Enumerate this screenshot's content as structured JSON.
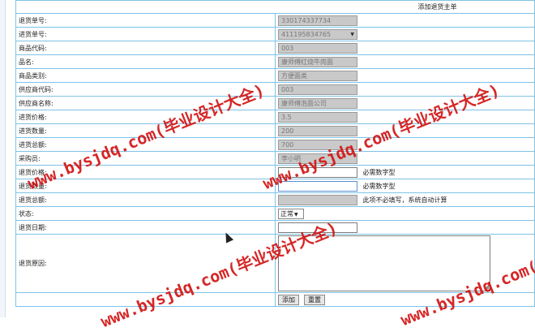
{
  "form": {
    "title": "添加退货主单",
    "rows": [
      {
        "label": "退货单号:",
        "value": "330174337734",
        "type": "gray"
      },
      {
        "label": "进货单号:",
        "value": "411195834765",
        "type": "select"
      },
      {
        "label": "商品代码:",
        "value": "003",
        "type": "gray"
      },
      {
        "label": "品名:",
        "value": "康师傅红烧牛肉面",
        "type": "gray"
      },
      {
        "label": "商品类别:",
        "value": "方便面类",
        "type": "gray"
      },
      {
        "label": "供应商代码:",
        "value": "003",
        "type": "gray"
      },
      {
        "label": "供应商名称:",
        "value": "康师傅泡面公司",
        "type": "gray"
      },
      {
        "label": "进货价格:",
        "value": "3.5",
        "type": "gray"
      },
      {
        "label": "进货数量:",
        "value": "200",
        "type": "gray"
      },
      {
        "label": "进货总额:",
        "value": "700",
        "type": "gray"
      },
      {
        "label": "采购员:",
        "value": "李小明",
        "type": "gray"
      },
      {
        "label": "退货价格:",
        "value": "",
        "type": "text",
        "hint": "必需数字型"
      },
      {
        "label": "退货数量:",
        "value": "",
        "type": "focus",
        "hint": "必需数字型"
      },
      {
        "label": "退货总额:",
        "value": "",
        "type": "disabled",
        "hint": "此项不必填写，系统自动计算"
      }
    ],
    "status": {
      "label": "状态:",
      "value": "正常"
    },
    "date": {
      "label": "退货日期:",
      "value": ""
    },
    "reason": {
      "label": "退货原因:",
      "value": ""
    },
    "buttons": {
      "add": "添加",
      "reset": "重置"
    }
  },
  "watermark": "www.bysjdq.com(毕业设计大全)"
}
